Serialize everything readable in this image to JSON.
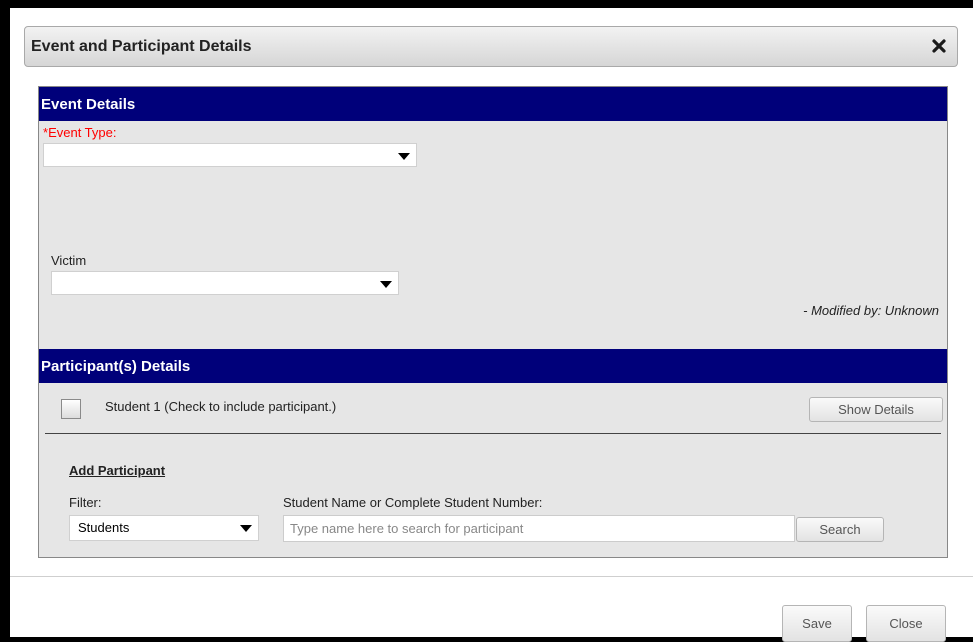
{
  "dialog": {
    "title": "Event and Participant Details",
    "close_icon": "close-x-icon"
  },
  "event_details": {
    "header": "Event Details",
    "event_type_required_marker": "*",
    "event_type_label": "Event Type:",
    "event_type_value": "",
    "victim_label": "Victim",
    "victim_value": "",
    "modified_text": "- Modified by: Unknown"
  },
  "participant_details": {
    "header": "Participant(s) Details",
    "participants": [
      {
        "label": "Student 1 (Check to include participant.)",
        "checked": false,
        "show_details_label": "Show Details"
      }
    ]
  },
  "add_participant": {
    "heading": "Add Participant",
    "filter_label": "Filter:",
    "filter_value": "Students",
    "search_label": "Student Name or Complete Student Number:",
    "search_placeholder": "Type name here to search for participant",
    "search_value": "",
    "search_button_label": "Search"
  },
  "footer": {
    "save_label": "Save",
    "close_label": "Close"
  },
  "colors": {
    "section_header_bg": "#00007a",
    "panel_bg": "#e6e6e6",
    "required_text": "#ff0000",
    "window_border": "#000000"
  }
}
